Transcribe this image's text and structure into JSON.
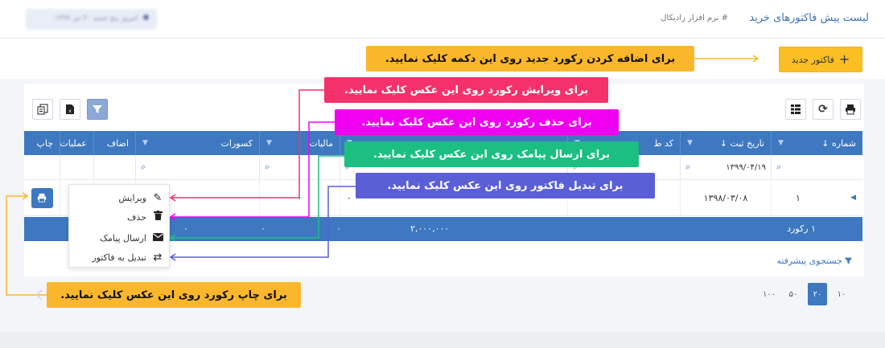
{
  "header": {
    "title": "لیست پیش فاکتورهای خرید",
    "breadcrumb": "# نرم افزار رادیکال",
    "date_text": "امروز پنج شنبه ۲۰ تیر ۱۳۹۹"
  },
  "toolbar": {
    "new_invoice_label": "فاکتور جدید",
    "plus_icon": "plus-icon"
  },
  "grid": {
    "columns": [
      {
        "label": "شماره ↓"
      },
      {
        "label": "تاریخ ثبت ↓"
      },
      {
        "label": "کد ط"
      },
      {
        "label": "تخفیف"
      },
      {
        "label": "مالیات"
      },
      {
        "label": "کسورات"
      },
      {
        "label": "اضاف"
      },
      {
        "label": "عملیات"
      },
      {
        "label": "چاپ"
      }
    ],
    "filter_date_value": "۱۳۹۹/۰۴/۱۹",
    "row": {
      "number": "۱",
      "date": "۱۳۹۸/۰۳/۰۸",
      "discount": "۰",
      "tax": "۰",
      "deductions": "۰"
    },
    "summary": {
      "records": "۱ رکورد",
      "total": "۲,۰۰۰,۰۰۰",
      "v1": "۰",
      "v2": "۰",
      "v3": "۰"
    },
    "advanced_search": "جستجوی پیشرفته",
    "pager": [
      "۱۰",
      "۲۰",
      "۵۰",
      "۱۰۰"
    ],
    "active_page_size": "۲۰"
  },
  "context_menu": {
    "items": [
      {
        "label": "ویرایش",
        "icon": "pencil-icon"
      },
      {
        "label": "حذف",
        "icon": "trash-icon"
      },
      {
        "label": "ارسال پیامک",
        "icon": "envelope-icon"
      },
      {
        "label": "تبدیل به فاکتور",
        "icon": "exchange-icon"
      }
    ]
  },
  "callouts": {
    "add": "برای اضافه کردن رکورد جدید روی این دکمه کلیک نمایید.",
    "edit": "برای ویرایش رکورد روی این عکس کلیک نمایید.",
    "delete": "برای حذف رکورد روی این عکس کلیک نمایید.",
    "sms": "برای ارسال پیامک روی این عکس کلیک نمایید.",
    "convert": "برای تبدیل فاکتور روی این عکس کلیک نمایید.",
    "print": "برای چاپ رکورد روی این عکس کلیک نمایید."
  },
  "colors": {
    "primary": "#3d78c0",
    "accent": "#fbbf24",
    "callout_red": "#f5316b",
    "callout_magenta": "#f000f0",
    "callout_green": "#1bbf82",
    "callout_indigo": "#5b5fd6"
  }
}
